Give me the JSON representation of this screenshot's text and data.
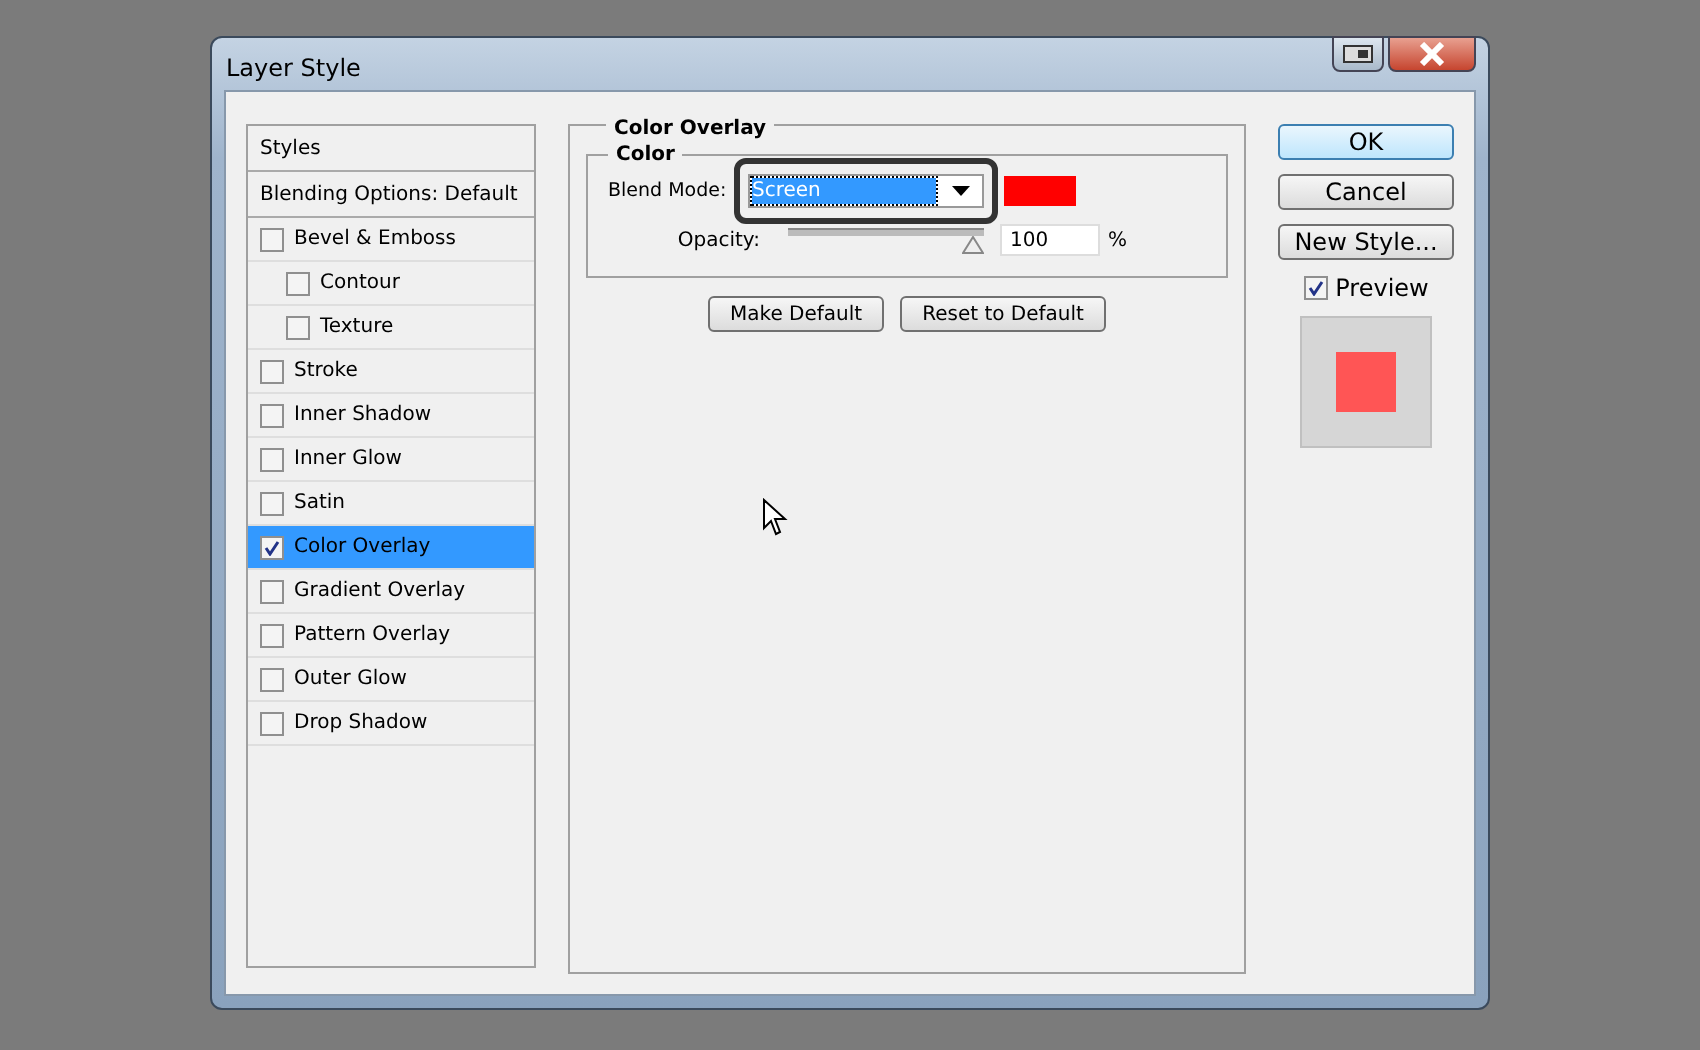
{
  "window": {
    "title": "Layer Style"
  },
  "sidebar": {
    "items": [
      {
        "kind": "header",
        "label": "Styles",
        "selected": false
      },
      {
        "kind": "header",
        "label": "Blending Options: Default",
        "selected": false
      },
      {
        "kind": "check",
        "label": "Bevel & Emboss",
        "checked": false,
        "selected": false,
        "children": [
          {
            "label": "Contour",
            "checked": false,
            "selected": false
          },
          {
            "label": "Texture",
            "checked": false,
            "selected": false
          }
        ]
      },
      {
        "kind": "check",
        "label": "Stroke",
        "checked": false,
        "selected": false
      },
      {
        "kind": "check",
        "label": "Inner Shadow",
        "checked": false,
        "selected": false
      },
      {
        "kind": "check",
        "label": "Inner Glow",
        "checked": false,
        "selected": false
      },
      {
        "kind": "check",
        "label": "Satin",
        "checked": false,
        "selected": false
      },
      {
        "kind": "check",
        "label": "Color Overlay",
        "checked": true,
        "selected": true
      },
      {
        "kind": "check",
        "label": "Gradient Overlay",
        "checked": false,
        "selected": false
      },
      {
        "kind": "check",
        "label": "Pattern Overlay",
        "checked": false,
        "selected": false
      },
      {
        "kind": "check",
        "label": "Outer Glow",
        "checked": false,
        "selected": false
      },
      {
        "kind": "check",
        "label": "Drop Shadow",
        "checked": false,
        "selected": false
      }
    ]
  },
  "panel": {
    "title": "Color Overlay",
    "group": "Color",
    "blend_mode_label": "Blend Mode:",
    "blend_mode": "Screen",
    "color": "#ff0000",
    "opacity_label": "Opacity:",
    "opacity": {
      "level": 1
    },
    "opacity_value": "100",
    "opacity_unit": "%",
    "buttons": [
      "Make Default",
      "Reset to Default"
    ]
  },
  "actions": {
    "buttons": [
      "OK",
      "Cancel",
      "New Style..."
    ],
    "preview_label": "Preview",
    "preview_checked": true
  }
}
